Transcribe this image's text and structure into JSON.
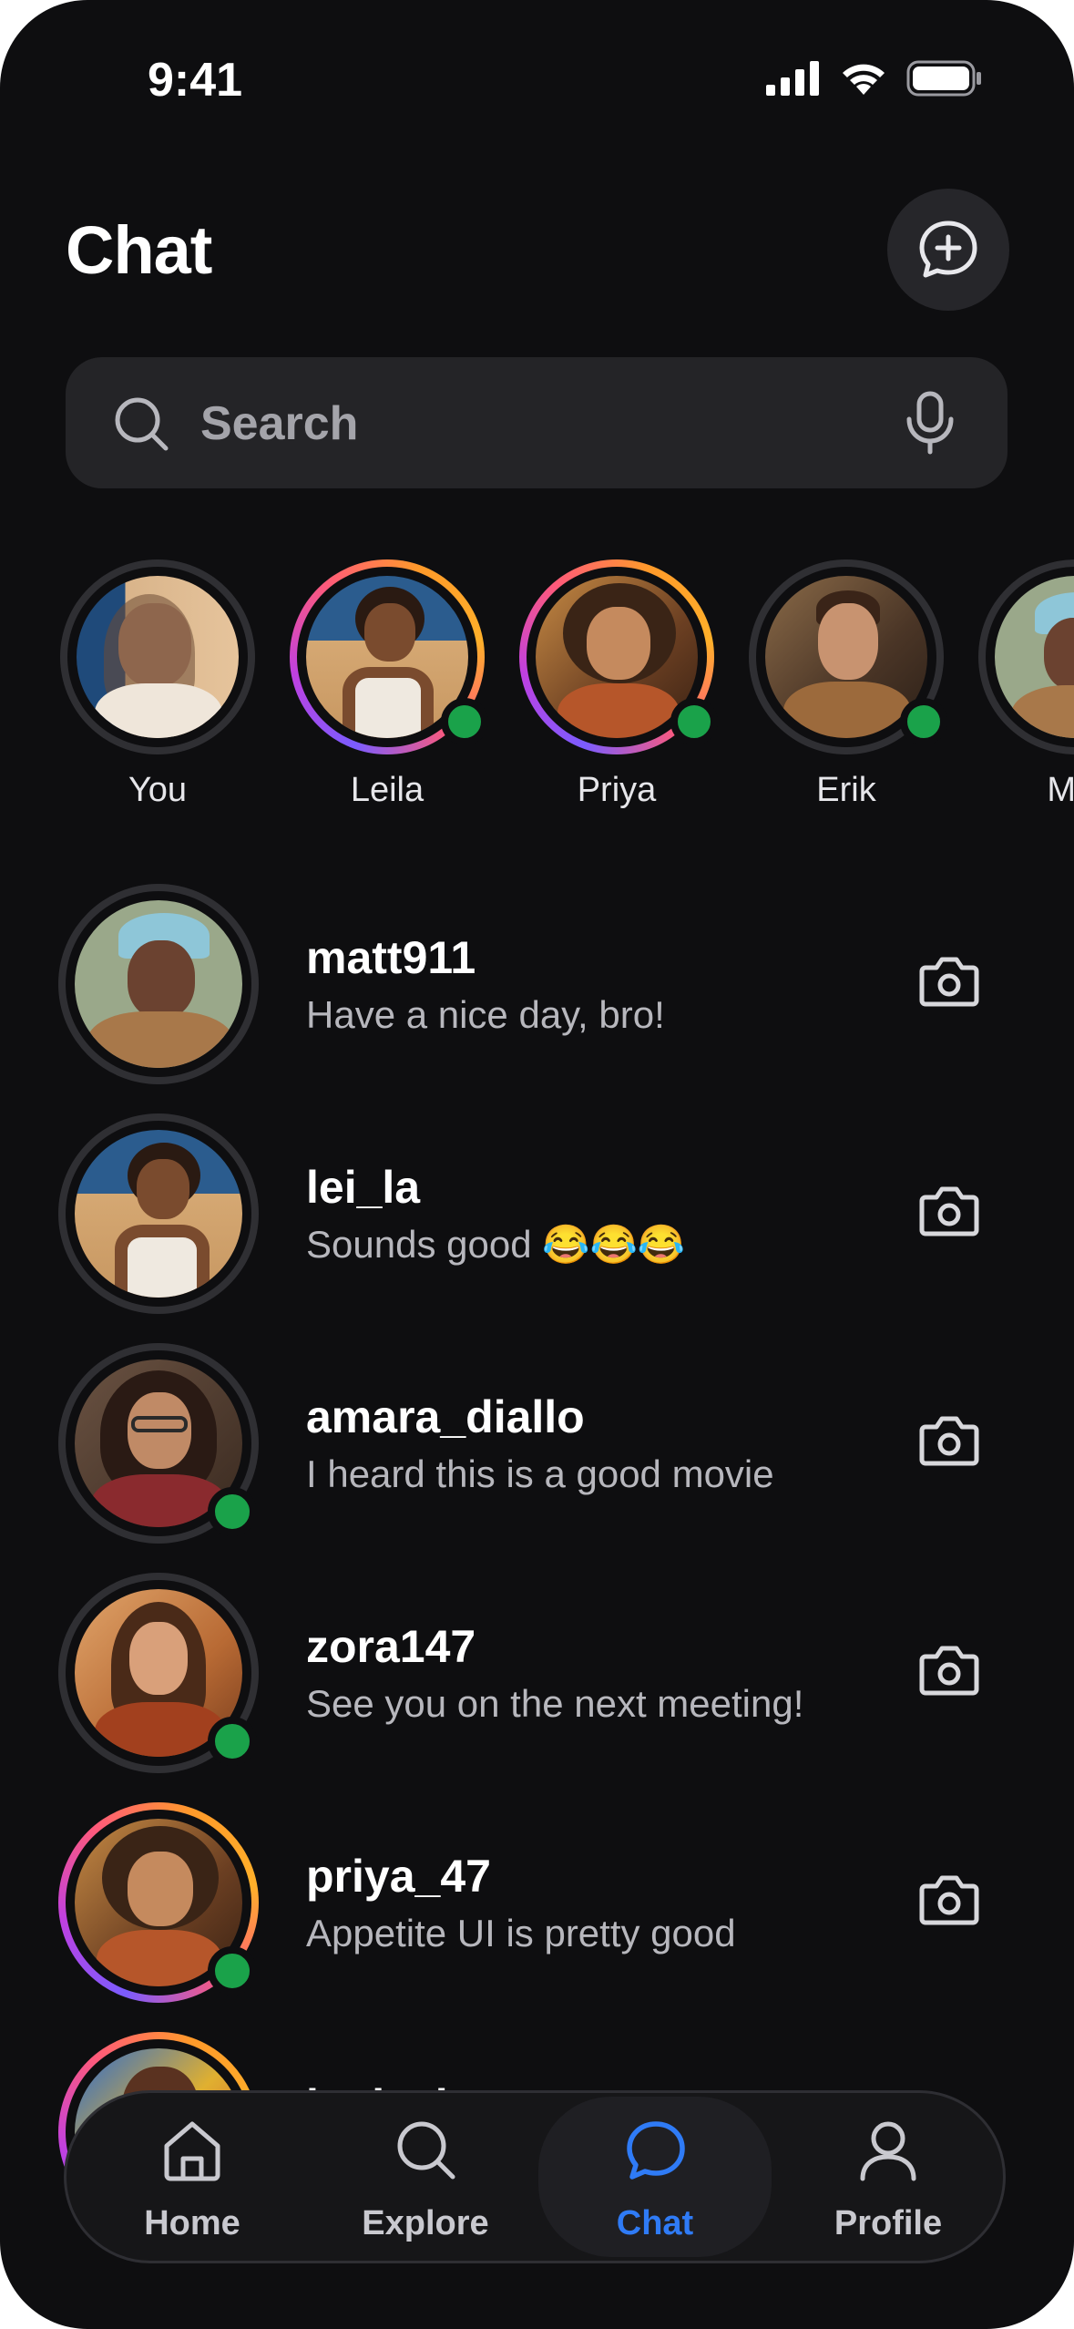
{
  "status_bar": {
    "time": "9:41",
    "icons": [
      "signal-icon",
      "wifi-icon",
      "battery-icon"
    ]
  },
  "header": {
    "title": "Chat",
    "new_chat_icon": "message-plus-icon"
  },
  "search": {
    "placeholder": "Search",
    "value": "",
    "icons": [
      "search-icon",
      "mic-icon"
    ]
  },
  "stories": [
    {
      "name": "You",
      "ring": "plain",
      "online": false
    },
    {
      "name": "Leila",
      "ring": "gradient",
      "online": true
    },
    {
      "name": "Priya",
      "ring": "gradient",
      "online": true
    },
    {
      "name": "Erik",
      "ring": "plain",
      "online": true
    },
    {
      "name": "Mat",
      "ring": "plain",
      "online": false
    }
  ],
  "chats": [
    {
      "username": "matt911",
      "message": "Have a nice day, bro!",
      "online": false,
      "ring": "plain"
    },
    {
      "username": "lei_la",
      "message": "Sounds good 😂😂😂",
      "online": false,
      "ring": "plain"
    },
    {
      "username": "amara_diallo",
      "message": "I heard this is a good movie",
      "online": true,
      "ring": "plain"
    },
    {
      "username": "zora147",
      "message": "See you on the next meeting!",
      "online": true,
      "ring": "plain"
    },
    {
      "username": "priya_47",
      "message": "Appetite UI is pretty good",
      "online": true,
      "ring": "gradient"
    },
    {
      "username": "lucia_j",
      "message": "",
      "online": false,
      "ring": "gradient"
    }
  ],
  "tabs": [
    {
      "label": "Home",
      "icon": "home-icon",
      "active": false
    },
    {
      "label": "Explore",
      "icon": "search-icon",
      "active": false
    },
    {
      "label": "Chat",
      "icon": "chat-bubble-icon",
      "active": true
    },
    {
      "label": "Profile",
      "icon": "user-icon",
      "active": false
    }
  ],
  "colors": {
    "background": "#0e0e10",
    "surface": "#242427",
    "online": "#1aa24a",
    "accent": "#2f7bf6",
    "muted_text": "#b7b7bd"
  }
}
